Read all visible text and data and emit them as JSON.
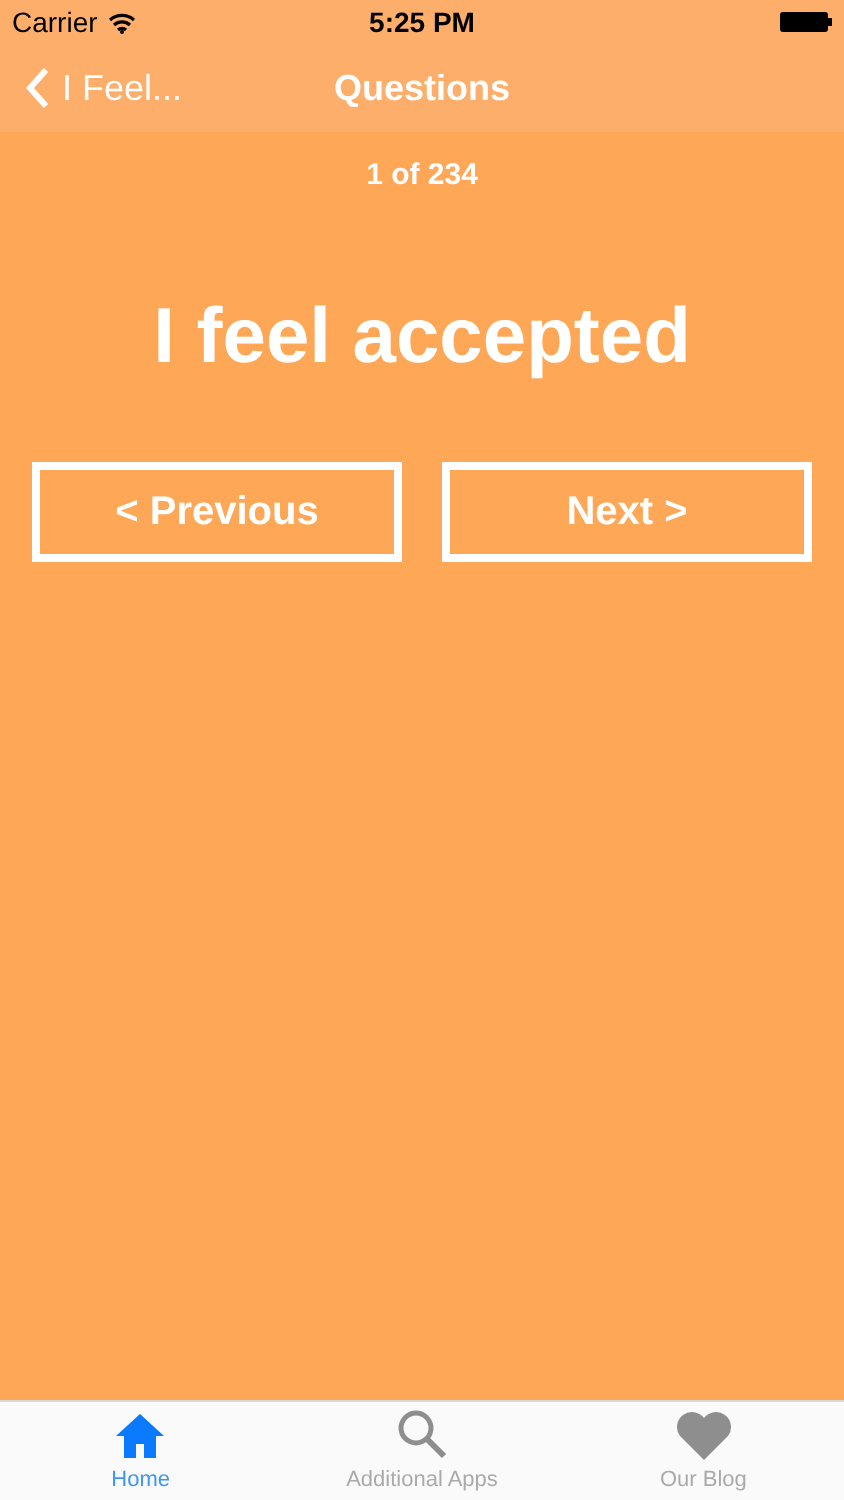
{
  "status_bar": {
    "carrier": "Carrier",
    "time": "5:25 PM"
  },
  "nav_bar": {
    "back": "I Feel...",
    "title": "Questions"
  },
  "counter": "1 of 234",
  "statement": "I feel accepted",
  "buttons": [
    {
      "label": "< Previous"
    },
    {
      "label": "Next >"
    }
  ],
  "tab_bar": [
    {
      "label": "Home",
      "selected": true
    },
    {
      "label": "Additional Apps",
      "selected": false
    },
    {
      "label": "Our Blog",
      "selected": false
    }
  ]
}
